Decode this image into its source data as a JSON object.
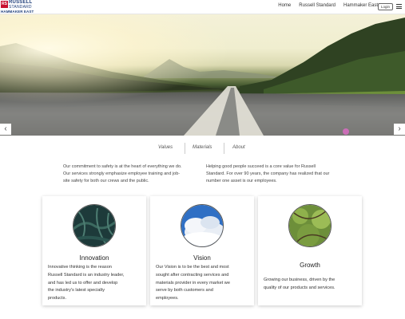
{
  "header": {
    "logo": {
      "mark": "RS",
      "line1": "RUSSELL",
      "line2": "STANDARD",
      "line3": "HAMMAKER EAST"
    },
    "nav": [
      "Home",
      "Russell Standard",
      "Hammaker East"
    ],
    "login_label": "Login",
    "menu_icon": "hamburger-icon"
  },
  "hero": {
    "prev_label": "‹",
    "next_label": "›"
  },
  "tabs": [
    "Values",
    "Materials",
    "About"
  ],
  "intro": {
    "left": [
      "Our commitment to safety is at the heart of everything we do.",
      "Our services strongly emphasize employee training and job-",
      "site safety for both our crews and the public."
    ],
    "right": [
      "Helping good people succeed is a core value for Russell",
      "Standard. For over 90 years, the company has realized that our",
      "number one asset is our employees."
    ]
  },
  "cards": [
    {
      "title": "Innovation",
      "lines": [
        "Innovative thinking is the reason",
        "Russell Standard is an industry leader,",
        "and has led us to offer and develop",
        "the industry's latest specialty",
        "products."
      ]
    },
    {
      "title": "Vision",
      "lines": [
        "Our Vision is to be the best and most",
        "sought after contracting services and",
        "materials provider in every market we",
        "serve by both customers and",
        "employees."
      ]
    },
    {
      "title": "Growth",
      "lines": [
        "Growing our business, driven by the",
        "quality of our products and services."
      ]
    }
  ],
  "colors": {
    "brand_red": "#c8102e",
    "brand_blue": "#1f3f7a"
  }
}
